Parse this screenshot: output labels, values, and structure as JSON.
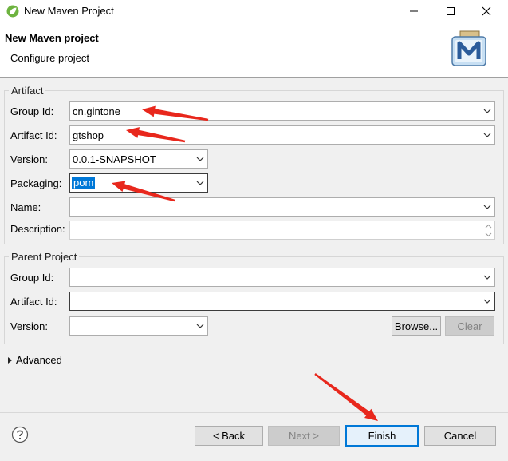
{
  "window": {
    "title": "New Maven Project",
    "icon": "spring-leaf-icon",
    "controls": [
      "minimize-icon",
      "maximize-icon",
      "close-icon"
    ]
  },
  "header": {
    "title": "New Maven project",
    "subtitle": "Configure project",
    "image": "maven-m-icon"
  },
  "artifact": {
    "legend": "Artifact",
    "group_id": {
      "label": "Group Id:",
      "value": "cn.gintone"
    },
    "artifact_id": {
      "label": "Artifact Id:",
      "value": "gtshop"
    },
    "version": {
      "label": "Version:",
      "value": "0.0.1-SNAPSHOT"
    },
    "packaging": {
      "label": "Packaging:",
      "value": "pom"
    },
    "name": {
      "label": "Name:",
      "value": ""
    },
    "description": {
      "label": "Description:",
      "value": ""
    }
  },
  "parent": {
    "legend": "Parent Project",
    "group_id": {
      "label": "Group Id:",
      "value": ""
    },
    "artifact_id": {
      "label": "Artifact Id:",
      "value": ""
    },
    "version": {
      "label": "Version:",
      "value": ""
    },
    "browse_label": "Browse...",
    "clear_label": "Clear"
  },
  "advanced": {
    "label": "Advanced"
  },
  "footer": {
    "help_icon": "help-question-icon",
    "back_label": "< Back",
    "next_label": "Next >",
    "finish_label": "Finish",
    "cancel_label": "Cancel"
  },
  "annotation_color": "#e8271c"
}
